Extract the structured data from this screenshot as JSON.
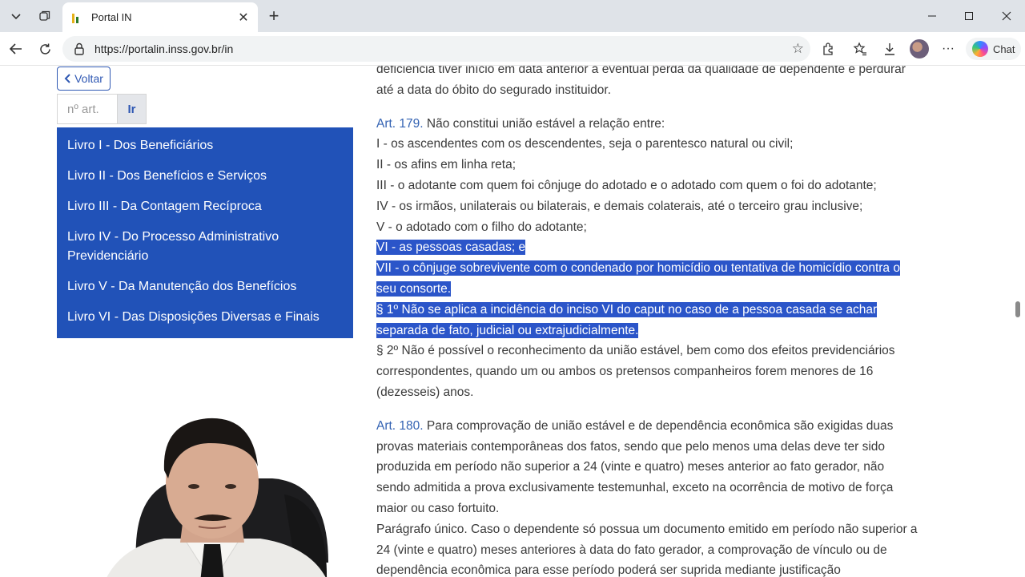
{
  "browser": {
    "tab_title": "Portal IN",
    "url": "https://portalin.inss.gov.br/in",
    "chat_label": "Chat"
  },
  "sidebar": {
    "back_label": "Voltar",
    "article_placeholder": "nº art.",
    "go_label": "Ir",
    "books": [
      {
        "label": "Livro I - Dos Beneficiários"
      },
      {
        "label": "Livro II - Dos Benefícios e Serviços"
      },
      {
        "label": "Livro III - Da Contagem Recíproca"
      },
      {
        "label": "Livro IV - Do Processo Administrativo Previdenciário"
      },
      {
        "label": "Livro V - Da Manutenção dos Benefícios"
      },
      {
        "label": "Livro VI - Das Disposições Diversas e Finais"
      }
    ]
  },
  "content": {
    "intro_lines": [
      "deficiência tiver início em data anterior à eventual perda da qualidade de dependente e perdurar",
      "até a data do óbito do segurado instituidor."
    ],
    "art179": {
      "label": "Art. 179.",
      "text": "Não constitui união estável a relação entre:",
      "items": [
        "I - os ascendentes com os descendentes, seja o parentesco natural ou civil;",
        "II - os afins em linha reta;",
        "III - o adotante com quem foi cônjuge do adotado e o adotado com quem o foi do adotante;",
        "IV - os irmãos, unilaterais ou bilaterais, e demais colaterais, até o terceiro grau inclusive;",
        "V - o adotado com o filho do adotante;"
      ],
      "highlighted": [
        "VI - as pessoas casadas; e",
        "VII - o cônjuge sobrevivente com o condenado por homicídio ou tentativa de homicídio contra o",
        "seu consorte.",
        "§ 1º Não se aplica a incidência do inciso VI do caput no caso de a pessoa casada se achar",
        "separada de fato, judicial ou extrajudicialmente."
      ],
      "para2_lines": [
        "§ 2º Não é possível o reconhecimento da união estável, bem como dos efeitos previdenciários",
        "correspondentes, quando um ou ambos os pretensos companheiros forem menores de 16",
        "(dezesseis) anos."
      ]
    },
    "art180": {
      "label": "Art. 180.",
      "first_line": "Para comprovação de união estável e de dependência econômica são exigidas duas",
      "lines": [
        "provas materiais contemporâneas dos fatos, sendo que pelo menos uma delas deve ter sido",
        "produzida em período não superior a 24 (vinte e quatro) meses anterior ao fato gerador, não",
        "sendo admitida a prova exclusivamente testemunhal, exceto na ocorrência de motivo de força",
        "maior ou caso fortuito.",
        "Parágrafo único. Caso o dependente só possua um documento emitido em período não superior a",
        "24 (vinte e quatro) meses anteriores à data do fato gerador, a comprovação de vínculo ou de",
        "dependência econômica para esse período poderá ser suprida mediante justificação"
      ]
    }
  },
  "colors": {
    "sidebar_bg": "#2152b8",
    "highlight_bg": "#2b55c9",
    "article_label": "#3463b3"
  }
}
